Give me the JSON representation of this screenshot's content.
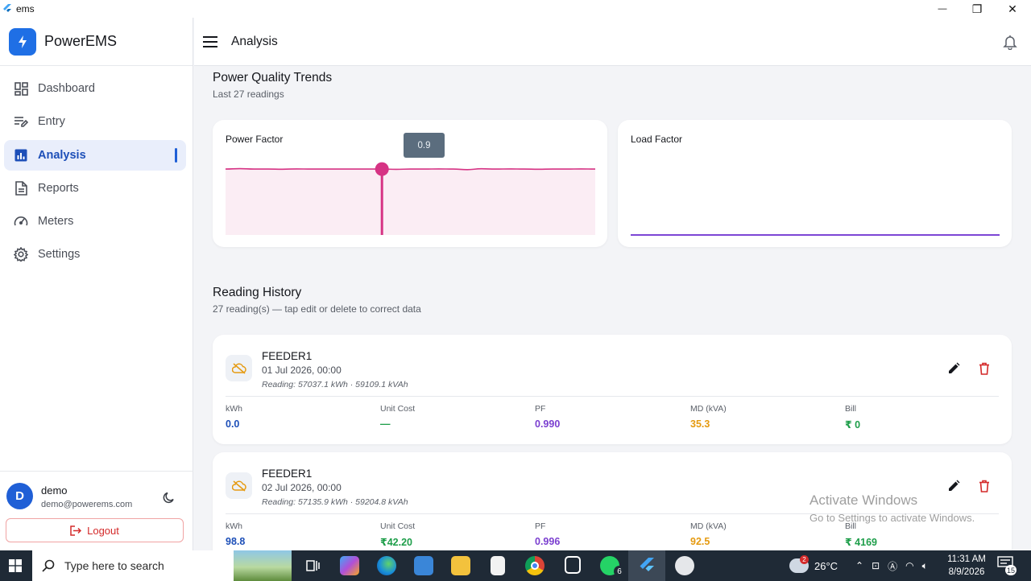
{
  "window": {
    "title": "ems",
    "minimize": "—",
    "maximize": "❐",
    "close": "✕"
  },
  "brand": {
    "name": "PowerEMS"
  },
  "sidebar": {
    "items": [
      {
        "label": "Dashboard",
        "icon": "dashboard-icon",
        "active": false
      },
      {
        "label": "Entry",
        "icon": "edit-list-icon",
        "active": false
      },
      {
        "label": "Analysis",
        "icon": "bar-chart-icon",
        "active": true
      },
      {
        "label": "Reports",
        "icon": "document-icon",
        "active": false
      },
      {
        "label": "Meters",
        "icon": "gauge-icon",
        "active": false
      },
      {
        "label": "Settings",
        "icon": "gear-icon",
        "active": false
      }
    ]
  },
  "user": {
    "initial": "D",
    "name": "demo",
    "email": "demo@powerems.com",
    "logout_label": "Logout"
  },
  "header": {
    "title": "Analysis"
  },
  "trends": {
    "title": "Power Quality Trends",
    "subtitle": "Last 27 readings",
    "power_factor": {
      "title": "Power Factor",
      "tooltip": "0.9"
    },
    "load_factor": {
      "title": "Load Factor"
    }
  },
  "chart_data": [
    {
      "type": "area",
      "title": "Power Factor",
      "color": "#d63384",
      "values": [
        0.99,
        0.996,
        0.99,
        0.99,
        0.988,
        0.992,
        0.99,
        0.99,
        0.99,
        0.99,
        0.99,
        0.99,
        0.986,
        0.99,
        0.99,
        0.993,
        0.99,
        0.982,
        0.995,
        0.99,
        0.993,
        0.99,
        0.988,
        0.99,
        0.99,
        0.992,
        0.99
      ],
      "highlight_index": 11,
      "highlight_label": "0.9",
      "ylim": [
        0,
        1.1
      ]
    },
    {
      "type": "line",
      "title": "Load Factor",
      "color": "#6a2ccf",
      "values": [
        0,
        0,
        0,
        0,
        0,
        0,
        0,
        0,
        0,
        0,
        0,
        0,
        0,
        0,
        0,
        0,
        0,
        0,
        0,
        0,
        0,
        0,
        0,
        0,
        0,
        0,
        0
      ],
      "ylim": [
        0,
        1
      ]
    }
  ],
  "history": {
    "title": "Reading History",
    "subtitle": "27 reading(s) — tap edit or delete to correct data",
    "metric_labels": [
      "kWh",
      "Unit Cost",
      "PF",
      "MD (kVA)",
      "Bill"
    ],
    "metric_colors": [
      "#1d4fb8",
      "#1e9e4a",
      "#7b3fd0",
      "#e59a10",
      "#1e9e4a"
    ],
    "readings": [
      {
        "feeder": "FEEDER1",
        "date": "01 Jul 2026, 00:00",
        "meta": "Reading: 57037.1 kWh · 59109.1 kVAh",
        "values": [
          "0.0",
          "—",
          "0.990",
          "35.3",
          "₹ 0"
        ]
      },
      {
        "feeder": "FEEDER1",
        "date": "02 Jul 2026, 00:00",
        "meta": "Reading: 57135.9 kWh · 59204.8 kVAh",
        "values": [
          "98.8",
          "₹42.20",
          "0.996",
          "92.5",
          "₹ 4169"
        ]
      }
    ]
  },
  "watermark": {
    "line1": "Activate Windows",
    "line2": "Go to Settings to activate Windows."
  },
  "taskbar": {
    "search_placeholder": "Type here to search",
    "whatsapp_badge": "6",
    "weather_badge": "2",
    "temperature": "26°C",
    "time": "11:31 AM",
    "date": "8/9/2026",
    "notification_count": "15"
  }
}
